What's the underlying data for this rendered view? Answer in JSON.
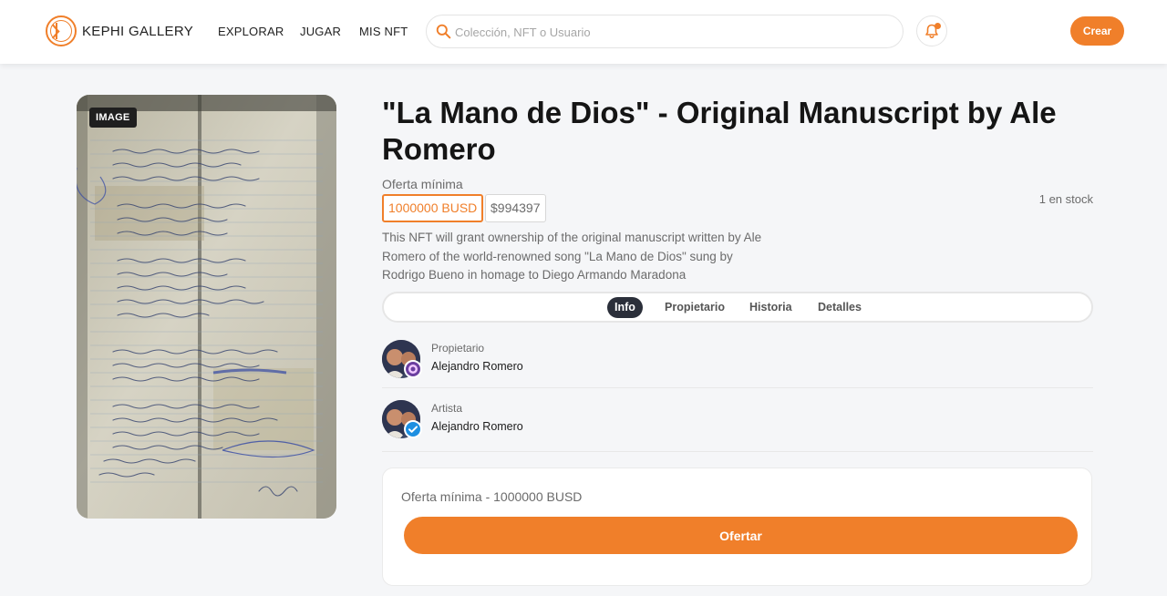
{
  "brand": {
    "name": "KEPHI GALLERY",
    "logo_icon": "kephi-logo-icon"
  },
  "nav": {
    "explore": "EXPLORAR",
    "play": "JUGAR",
    "my_nft": "MIS NFT"
  },
  "search": {
    "placeholder": "Colección, NFT o Usuario"
  },
  "header": {
    "create_label": "Crear"
  },
  "colors": {
    "accent": "#f07f2a",
    "dark": "#2b2f3a",
    "background": "#f5f6f8"
  },
  "media": {
    "badge": "IMAGE"
  },
  "nft": {
    "title": "\"La Mano de Dios\" - Original Manuscript by Ale Romero",
    "min_offer_label": "Oferta mínima",
    "price_crypto": "1000000 BUSD",
    "price_usd": "$994397",
    "stock": "1 en stock",
    "description": "This NFT will grant ownership of the original manuscript written by Ale Romero of the world-renowned song \"La Mano de Dios\" sung by Rodrigo Bueno in homage to Diego Armando Maradona"
  },
  "tabs": [
    {
      "label": "Info",
      "active": true
    },
    {
      "label": "Propietario",
      "active": false
    },
    {
      "label": "Historia",
      "active": false
    },
    {
      "label": "Detalles",
      "active": false
    }
  ],
  "owner": {
    "role": "Propietario",
    "name": "Alejandro Romero",
    "badge_icon": "owner-badge-icon"
  },
  "artist": {
    "role": "Artista",
    "name": "Alejandro Romero",
    "badge_icon": "verified-check-icon"
  },
  "offer": {
    "summary": "Oferta mínima - 1000000 BUSD",
    "button_label": "Ofertar"
  }
}
